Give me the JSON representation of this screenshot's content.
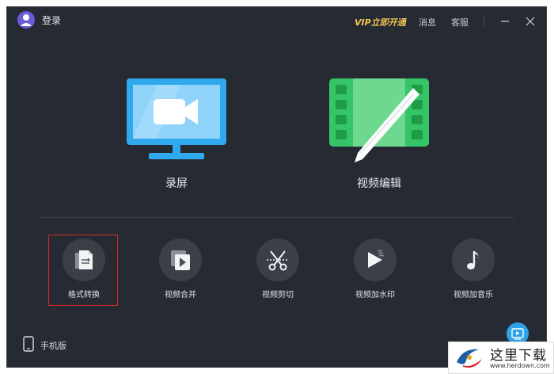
{
  "titlebar": {
    "login_label": "登录",
    "vip_label": "VIP立即开通",
    "message_label": "消息",
    "service_label": "客服"
  },
  "main_tiles": [
    {
      "label": "录屏",
      "icon": "monitor-camera-icon",
      "color": "#2fa8ee"
    },
    {
      "label": "视频编辑",
      "icon": "film-pen-icon",
      "color": "#35c567"
    }
  ],
  "tools": [
    {
      "label": "格式转换",
      "icon": "file-convert-icon",
      "highlighted": true
    },
    {
      "label": "视频合并",
      "icon": "video-merge-icon"
    },
    {
      "label": "视频剪切",
      "icon": "scissors-icon"
    },
    {
      "label": "视频加水印",
      "icon": "play-watermark-icon"
    },
    {
      "label": "视频加音乐",
      "icon": "music-note-icon"
    }
  ],
  "mobile_label": "手机版",
  "watermark": {
    "text": "这里下载",
    "url": "www.herdown.com"
  },
  "colors": {
    "background": "#262b33",
    "accent_vip": "#f5c451",
    "highlight_border": "#d9262c"
  }
}
